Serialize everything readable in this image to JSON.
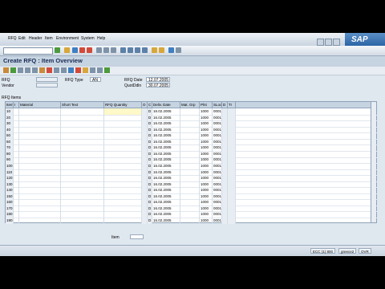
{
  "menu": {
    "items": [
      "RFQ",
      "Edit",
      "Header",
      "Item",
      "Environment",
      "System",
      "Help"
    ]
  },
  "sap_logo": "SAP",
  "title": "Create RFQ : Item Overview",
  "header_fields": {
    "rfq_label": "RFQ",
    "rfq_type_label": "RFQ Type",
    "rfq_type_value": "AN",
    "rfq_date_label": "RFQ Date",
    "rfq_date_value": "12.07.2005",
    "quot_deadline_label": "QuotDdln",
    "quot_deadline_value": "30.07.2005",
    "vendor_label": "Vendor"
  },
  "section_label": "RFQ Items",
  "table": {
    "columns": [
      "Item",
      "I",
      "Material",
      "Short Text",
      "RFQ Quantity",
      "O",
      "C",
      "Deliv. Date",
      "Mat. Grp",
      "Plnt",
      "SLoc",
      "D",
      "Tr"
    ],
    "rows": [
      {
        "item": "10",
        "c": "D",
        "date": "16.02.2005",
        "plnt": "1000",
        "sloc": "0001"
      },
      {
        "item": "20",
        "c": "D",
        "date": "16.02.2005",
        "plnt": "1000",
        "sloc": "0001"
      },
      {
        "item": "30",
        "c": "D",
        "date": "16.02.2005",
        "plnt": "1000",
        "sloc": "0001"
      },
      {
        "item": "40",
        "c": "D",
        "date": "16.02.2005",
        "plnt": "1000",
        "sloc": "0001"
      },
      {
        "item": "50",
        "c": "D",
        "date": "16.02.2005",
        "plnt": "1000",
        "sloc": "0001"
      },
      {
        "item": "60",
        "c": "D",
        "date": "16.02.2005",
        "plnt": "1000",
        "sloc": "0001"
      },
      {
        "item": "70",
        "c": "D",
        "date": "16.02.2005",
        "plnt": "1000",
        "sloc": "0001"
      },
      {
        "item": "80",
        "c": "D",
        "date": "16.02.2005",
        "plnt": "1000",
        "sloc": "0001"
      },
      {
        "item": "90",
        "c": "D",
        "date": "16.02.2005",
        "plnt": "1000",
        "sloc": "0001"
      },
      {
        "item": "100",
        "c": "D",
        "date": "16.02.2005",
        "plnt": "1000",
        "sloc": "0001"
      },
      {
        "item": "110",
        "c": "D",
        "date": "16.02.2005",
        "plnt": "1000",
        "sloc": "0001"
      },
      {
        "item": "120",
        "c": "D",
        "date": "16.02.2005",
        "plnt": "1000",
        "sloc": "0001"
      },
      {
        "item": "130",
        "c": "D",
        "date": "16.02.2005",
        "plnt": "1000",
        "sloc": "0001"
      },
      {
        "item": "140",
        "c": "D",
        "date": "16.02.2005",
        "plnt": "1000",
        "sloc": "0001"
      },
      {
        "item": "150",
        "c": "D",
        "date": "16.02.2005",
        "plnt": "1000",
        "sloc": "0001"
      },
      {
        "item": "160",
        "c": "D",
        "date": "16.02.2005",
        "plnt": "1000",
        "sloc": "0001"
      },
      {
        "item": "170",
        "c": "D",
        "date": "16.02.2005",
        "plnt": "1000",
        "sloc": "0001"
      },
      {
        "item": "180",
        "c": "D",
        "date": "16.02.2005",
        "plnt": "1000",
        "sloc": "0001"
      },
      {
        "item": "190",
        "c": "D",
        "date": "16.02.2005",
        "plnt": "1000",
        "sloc": "0001"
      }
    ]
  },
  "footer": {
    "item_label": "Item"
  },
  "status": {
    "system": "ECC (1) 800",
    "server": "greece2",
    "mode": "OVR"
  }
}
